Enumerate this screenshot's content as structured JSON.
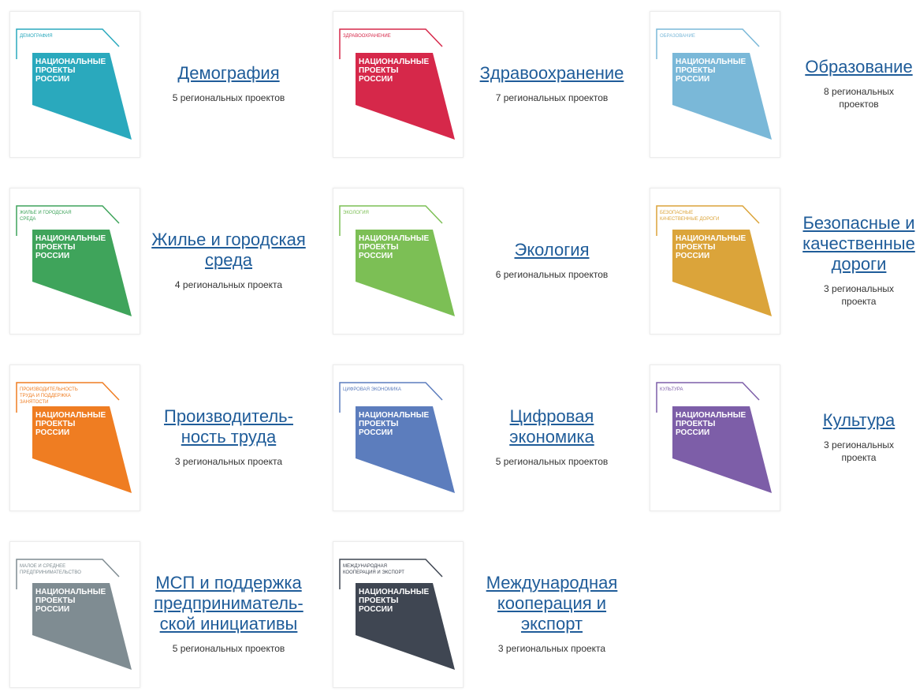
{
  "logo_text": "НАЦИОНАЛЬНЫЕ ПРОЕКТЫ РОССИИ",
  "projects": [
    {
      "logo_label": "ДЕМОГРАФИЯ",
      "title": "Демография",
      "count": "5 региональных проектов",
      "color": "#2aa9bd"
    },
    {
      "logo_label": "ЗДРАВООХРАНЕНИЕ",
      "title": "Здравоохранение",
      "count": "7 региональных проектов",
      "color": "#d6284a"
    },
    {
      "logo_label": "ОБРАЗОВАНИЕ",
      "title": "Образование",
      "count": "8 региональных проектов",
      "color": "#7ab8d8"
    },
    {
      "logo_label": "ЖИЛЬЕ И ГОРОДСКАЯ СРЕДА",
      "title": "Жилье и городская среда",
      "count": "4 региональных проекта",
      "color": "#3fa45b"
    },
    {
      "logo_label": "ЭКОЛОГИЯ",
      "title": "Экология",
      "count": "6 региональных проектов",
      "color": "#7cbf55"
    },
    {
      "logo_label": "БЕЗОПАСНЫЕ КАЧЕСТВЕННЫЕ ДОРОГИ",
      "title": "Безопасные и качественные дороги",
      "count": "3 региональных проекта",
      "color": "#dba43a"
    },
    {
      "logo_label": "ПРОИЗВОДИТЕЛЬНОСТЬ ТРУДА И ПОДДЕРЖКА ЗАНЯТОСТИ",
      "title": "Производитель-ность труда",
      "count": "3 региональных проекта",
      "color": "#ef7d22"
    },
    {
      "logo_label": "ЦИФРОВАЯ ЭКОНОМИКА",
      "title": "Цифровая экономика",
      "count": "5 региональных проектов",
      "color": "#5c7dbd"
    },
    {
      "logo_label": "КУЛЬТУРА",
      "title": "Культура",
      "count": "3 региональных проекта",
      "color": "#7d5ea8"
    },
    {
      "logo_label": "МАЛОЕ И СРЕДНЕЕ ПРЕДПРИНИМАТЕЛЬСТВО",
      "title": "МСП и поддержка предприниматель-ской инициативы",
      "count": "5 региональных проектов",
      "color": "#7f8c92"
    },
    {
      "logo_label": "МЕЖДУНАРОДНАЯ КООПЕРАЦИЯ И ЭКСПОРТ",
      "title": "Международная кооперация и экспорт",
      "count": "3 региональных проекта",
      "color": "#3f4652"
    }
  ]
}
